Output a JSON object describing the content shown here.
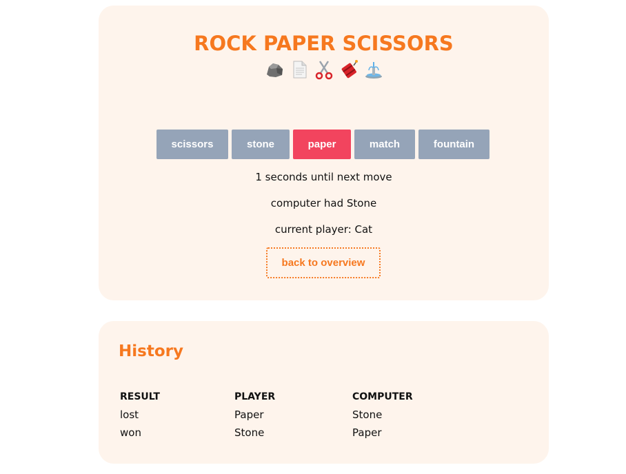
{
  "game": {
    "title": "ROCK PAPER SCISSORS",
    "icons": [
      "rock-icon",
      "paper-icon",
      "scissors-icon",
      "dynamite-icon",
      "fountain-icon"
    ],
    "choices": [
      {
        "label": "scissors",
        "selected": false
      },
      {
        "label": "stone",
        "selected": false
      },
      {
        "label": "paper",
        "selected": true
      },
      {
        "label": "match",
        "selected": false
      },
      {
        "label": "fountain",
        "selected": false
      }
    ],
    "countdown_text": "1 seconds until next move",
    "computer_text": "computer had Stone",
    "player_text": "current player: Cat",
    "back_label": "back to overview"
  },
  "history": {
    "title": "History",
    "headers": [
      "RESULT",
      "PLAYER",
      "COMPUTER"
    ],
    "rows": [
      [
        "lost",
        "Paper",
        "Stone"
      ],
      [
        "won",
        "Stone",
        "Paper"
      ]
    ]
  },
  "colors": {
    "accent": "#f6781f",
    "card_bg": "#fef4ec",
    "button": "#95a4b8",
    "button_selected": "#f2445e"
  }
}
